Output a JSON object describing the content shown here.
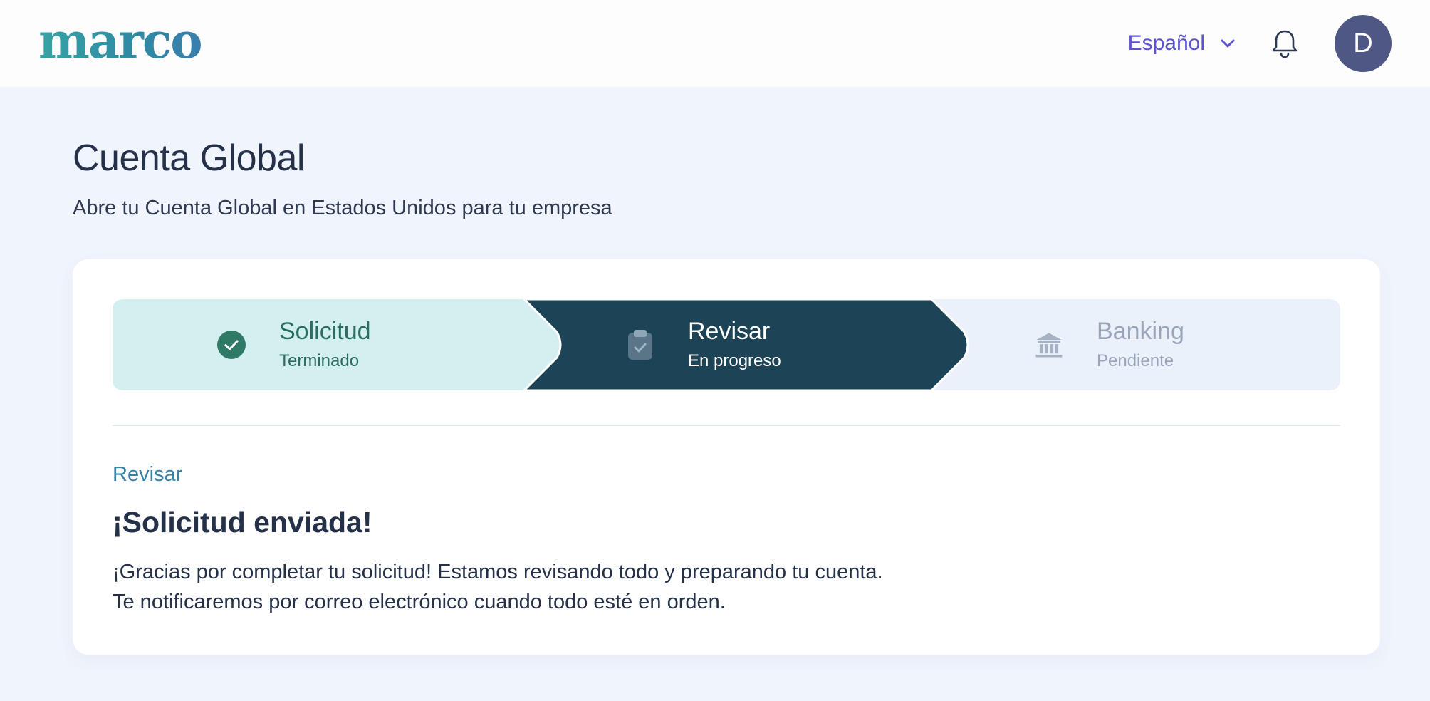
{
  "header": {
    "logo_text": "marco",
    "language_label": "Español",
    "avatar_initial": "D"
  },
  "page": {
    "title": "Cuenta Global",
    "subtitle": "Abre tu Cuenta Global en Estados Unidos para tu empresa"
  },
  "stepper": {
    "steps": [
      {
        "label": "Solicitud",
        "status": "Terminado",
        "icon": "check-circle-icon",
        "state": "completed"
      },
      {
        "label": "Revisar",
        "status": "En progreso",
        "icon": "clipboard-check-icon",
        "state": "active"
      },
      {
        "label": "Banking",
        "status": "Pendiente",
        "icon": "bank-icon",
        "state": "pending"
      }
    ]
  },
  "review": {
    "section_label": "Revisar",
    "heading": "¡Solicitud enviada!",
    "body_line1": "¡Gracias por completar tu solicitud! Estamos revisando todo y preparando tu cuenta.",
    "body_line2": "Te notificaremos por correo electrónico cuando todo esté en orden."
  },
  "colors": {
    "brand_teal": "#3aa3a5",
    "accent_purple": "#5b52d4",
    "step_completed_bg": "#d3eff0",
    "step_active_bg": "#1d4356",
    "step_pending_bg": "#ebf1fb",
    "avatar_bg": "#4f5785",
    "page_bg": "#f0f4fc"
  }
}
